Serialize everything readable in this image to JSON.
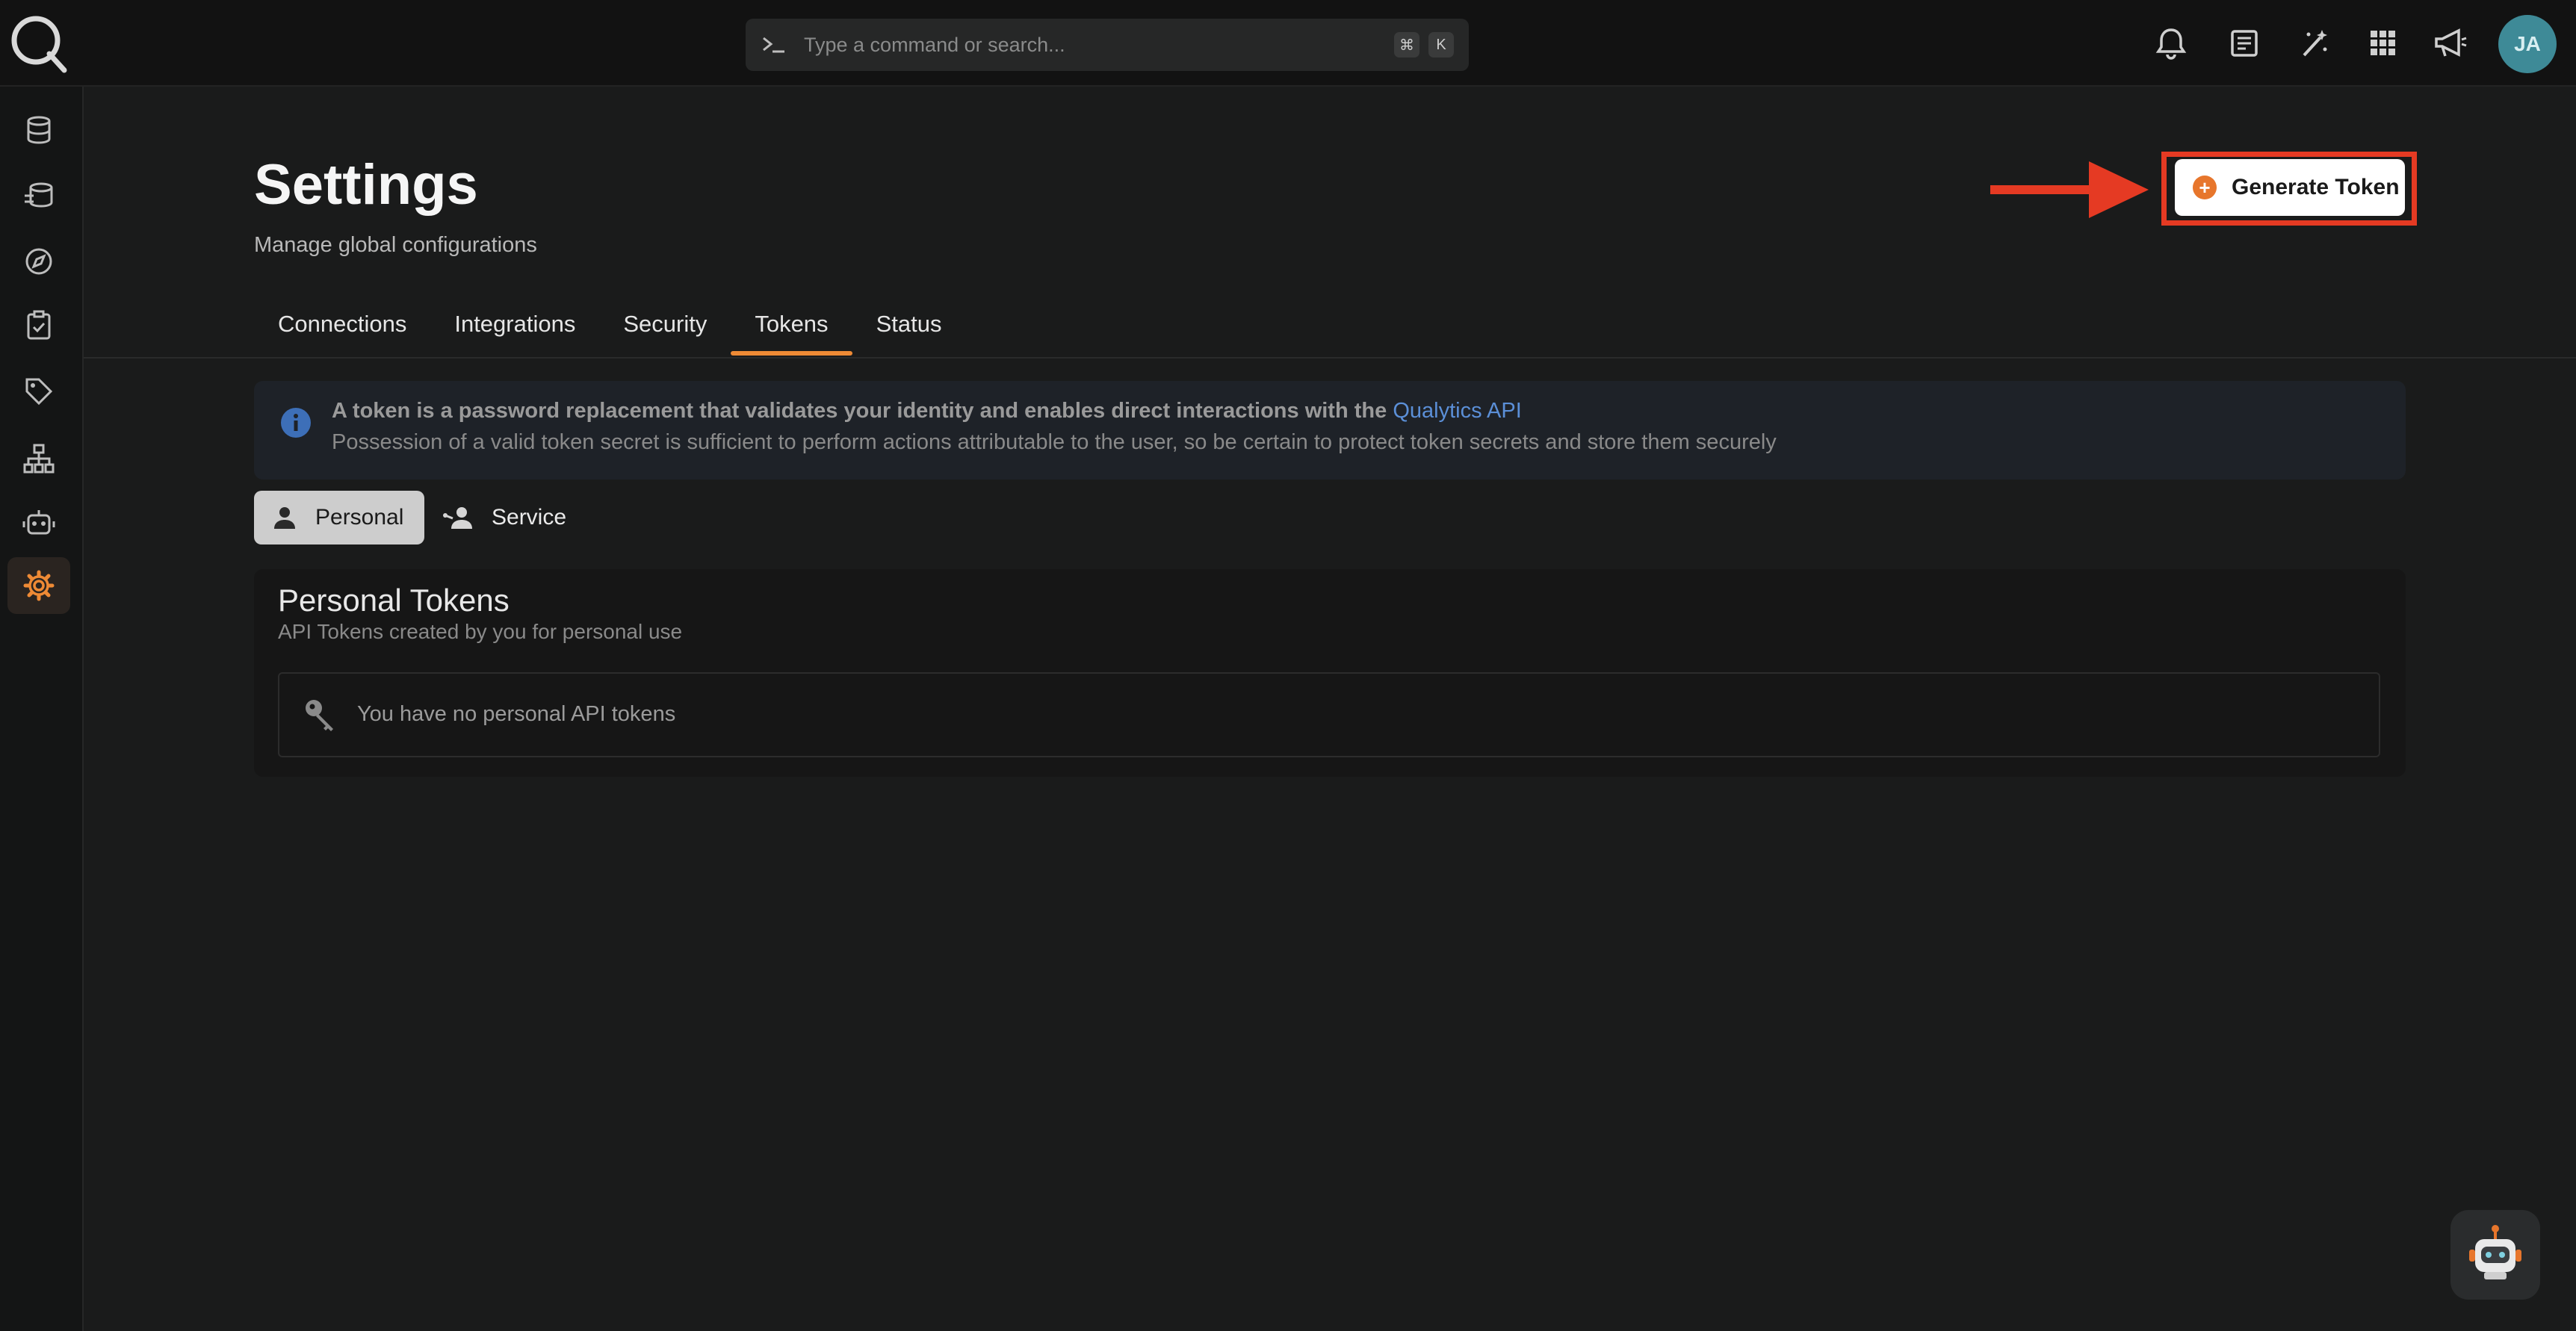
{
  "topbar": {
    "search_placeholder": "Type a command or search...",
    "shortcut_keys": [
      "⌘",
      "K"
    ],
    "icons": [
      "bell-icon",
      "document-icon",
      "magic-wand-icon",
      "apps-grid-icon",
      "megaphone-icon"
    ],
    "avatar_initials": "JA"
  },
  "sidebar": {
    "items": [
      "database-icon",
      "datastore-stack-icon",
      "compass-icon",
      "clipboard-check-icon",
      "tag-icon",
      "hierarchy-icon",
      "robot-icon",
      "gear-icon"
    ],
    "active": "gear-icon"
  },
  "page": {
    "title": "Settings",
    "subtitle": "Manage global configurations",
    "generate_button": "Generate Token"
  },
  "tabs": [
    {
      "label": "Connections",
      "active": false
    },
    {
      "label": "Integrations",
      "active": false
    },
    {
      "label": "Security",
      "active": false
    },
    {
      "label": "Tokens",
      "active": true
    },
    {
      "label": "Status",
      "active": false
    }
  ],
  "info": {
    "line1": "A token is a password replacement that validates your identity and enables direct interactions with the",
    "link": "Qualytics API",
    "line2": "Possession of a valid token secret is sufficient to perform actions attributable to the user, so be certain to protect token secrets and store them securely"
  },
  "token_types": {
    "personal": "Personal",
    "service": "Service",
    "selected": "Personal"
  },
  "personal_tokens": {
    "title": "Personal Tokens",
    "subtitle": "API Tokens created by you for personal use",
    "empty_message": "You have no personal API tokens"
  },
  "colors": {
    "accent": "#ee8a35",
    "highlight": "#e53a23",
    "link": "#5b8fd7",
    "avatar": "#3e8a97"
  }
}
